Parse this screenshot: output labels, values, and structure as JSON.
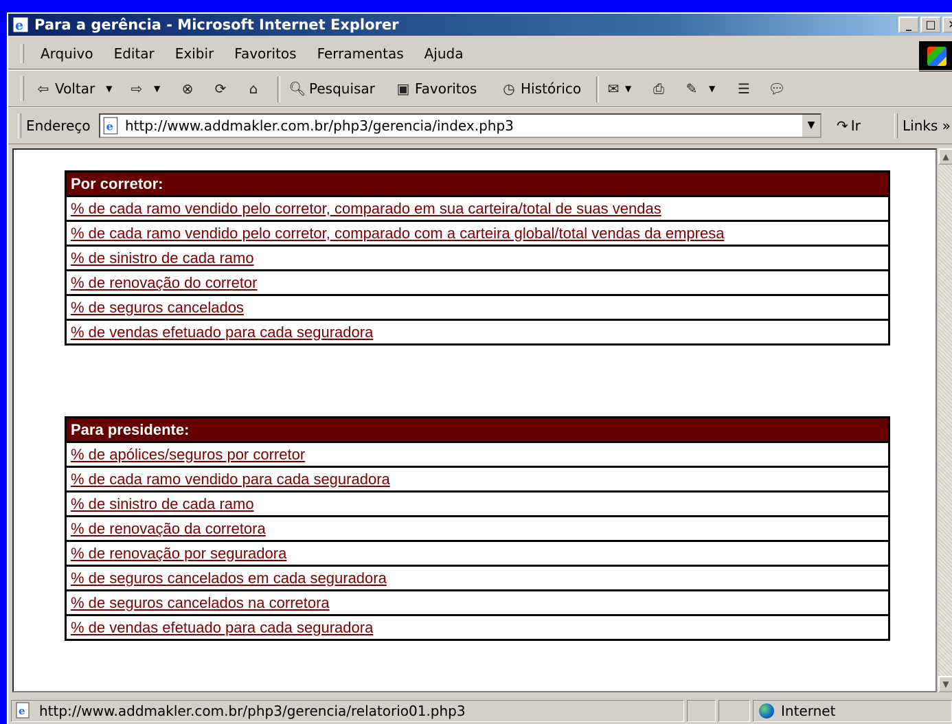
{
  "window": {
    "title": "Para a gerência - Microsoft Internet Explorer",
    "min_glyph": "_",
    "max_glyph": "□",
    "close_glyph": "✕"
  },
  "menu": [
    "Arquivo",
    "Editar",
    "Exibir",
    "Favoritos",
    "Ferramentas",
    "Ajuda"
  ],
  "toolbar": {
    "back_label": "Voltar",
    "search_label": "Pesquisar",
    "favorites_label": "Favoritos",
    "history_label": "Histórico"
  },
  "address": {
    "label": "Endereço",
    "url": "http://www.addmakler.com.br/php3/gerencia/index.php3",
    "go_label": "Ir",
    "links_label": "Links"
  },
  "sections": [
    {
      "header": "Por corretor:",
      "links": [
        "% de cada ramo vendido pelo corretor, comparado em sua carteira/total de suas vendas",
        "% de cada ramo vendido pelo corretor, comparado com a carteira global/total vendas da empresa",
        "% de sinistro de cada ramo",
        "% de renovação do corretor",
        "% de seguros cancelados",
        "% de vendas efetuado para cada seguradora"
      ]
    },
    {
      "header": "Para presidente:",
      "links": [
        "% de apólices/seguros por corretor",
        "% de cada ramo vendido para cada seguradora",
        "% de sinistro de cada ramo",
        "% de renovação da corretora",
        "% de renovação por seguradora",
        "% de seguros cancelados em cada seguradora",
        "% de seguros cancelados na corretora",
        "% de vendas efetuado para cada seguradora"
      ]
    }
  ],
  "status": {
    "url": "http://www.addmakler.com.br/php3/gerencia/relatorio01.php3",
    "zone": "Internet"
  },
  "colors": {
    "header_bg": "#660000",
    "link": "#800000",
    "desktop": "#0000ff"
  }
}
